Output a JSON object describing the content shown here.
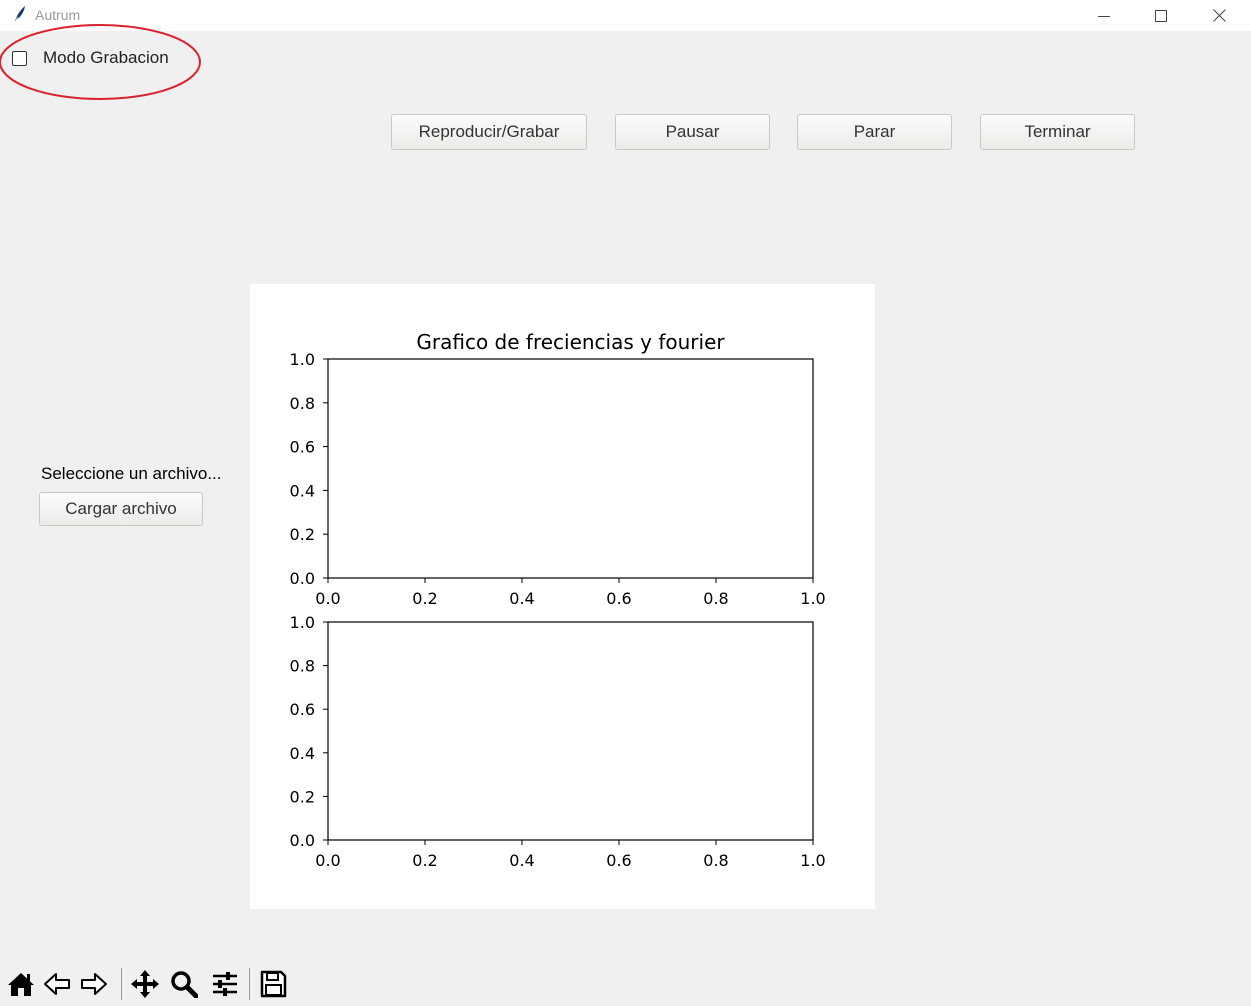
{
  "window": {
    "title": "Autrum",
    "icons": [
      "feather-icon",
      "minimize-icon",
      "maximize-icon",
      "close-icon"
    ]
  },
  "recording_mode": {
    "label": "Modo Grabacion",
    "checked": false,
    "highlight_color": "#d9232e"
  },
  "controls": {
    "play_record": "Reproducir/Grabar",
    "pause": "Pausar",
    "stop": "Parar",
    "finish": "Terminar"
  },
  "file": {
    "prompt": "Seleccione un archivo...",
    "load_button": "Cargar archivo"
  },
  "chart_data": [
    {
      "type": "line",
      "title": "Grafico de freciencias y fourier",
      "xlabel": "",
      "ylabel": "",
      "xlim": [
        0.0,
        1.0
      ],
      "ylim": [
        0.0,
        1.0
      ],
      "xticks": [
        "0.0",
        "0.2",
        "0.4",
        "0.6",
        "0.8",
        "1.0"
      ],
      "yticks": [
        "0.0",
        "0.2",
        "0.4",
        "0.6",
        "0.8",
        "1.0"
      ],
      "series": []
    },
    {
      "type": "line",
      "title": "",
      "xlabel": "",
      "ylabel": "",
      "xlim": [
        0.0,
        1.0
      ],
      "ylim": [
        0.0,
        1.0
      ],
      "xticks": [
        "0.0",
        "0.2",
        "0.4",
        "0.6",
        "0.8",
        "1.0"
      ],
      "yticks": [
        "0.0",
        "0.2",
        "0.4",
        "0.6",
        "0.8",
        "1.0"
      ],
      "series": []
    }
  ],
  "toolbar": {
    "icons": [
      "home-icon",
      "back-arrow-icon",
      "forward-arrow-icon",
      "pan-icon",
      "zoom-icon",
      "configure-subplots-icon",
      "save-icon"
    ]
  }
}
